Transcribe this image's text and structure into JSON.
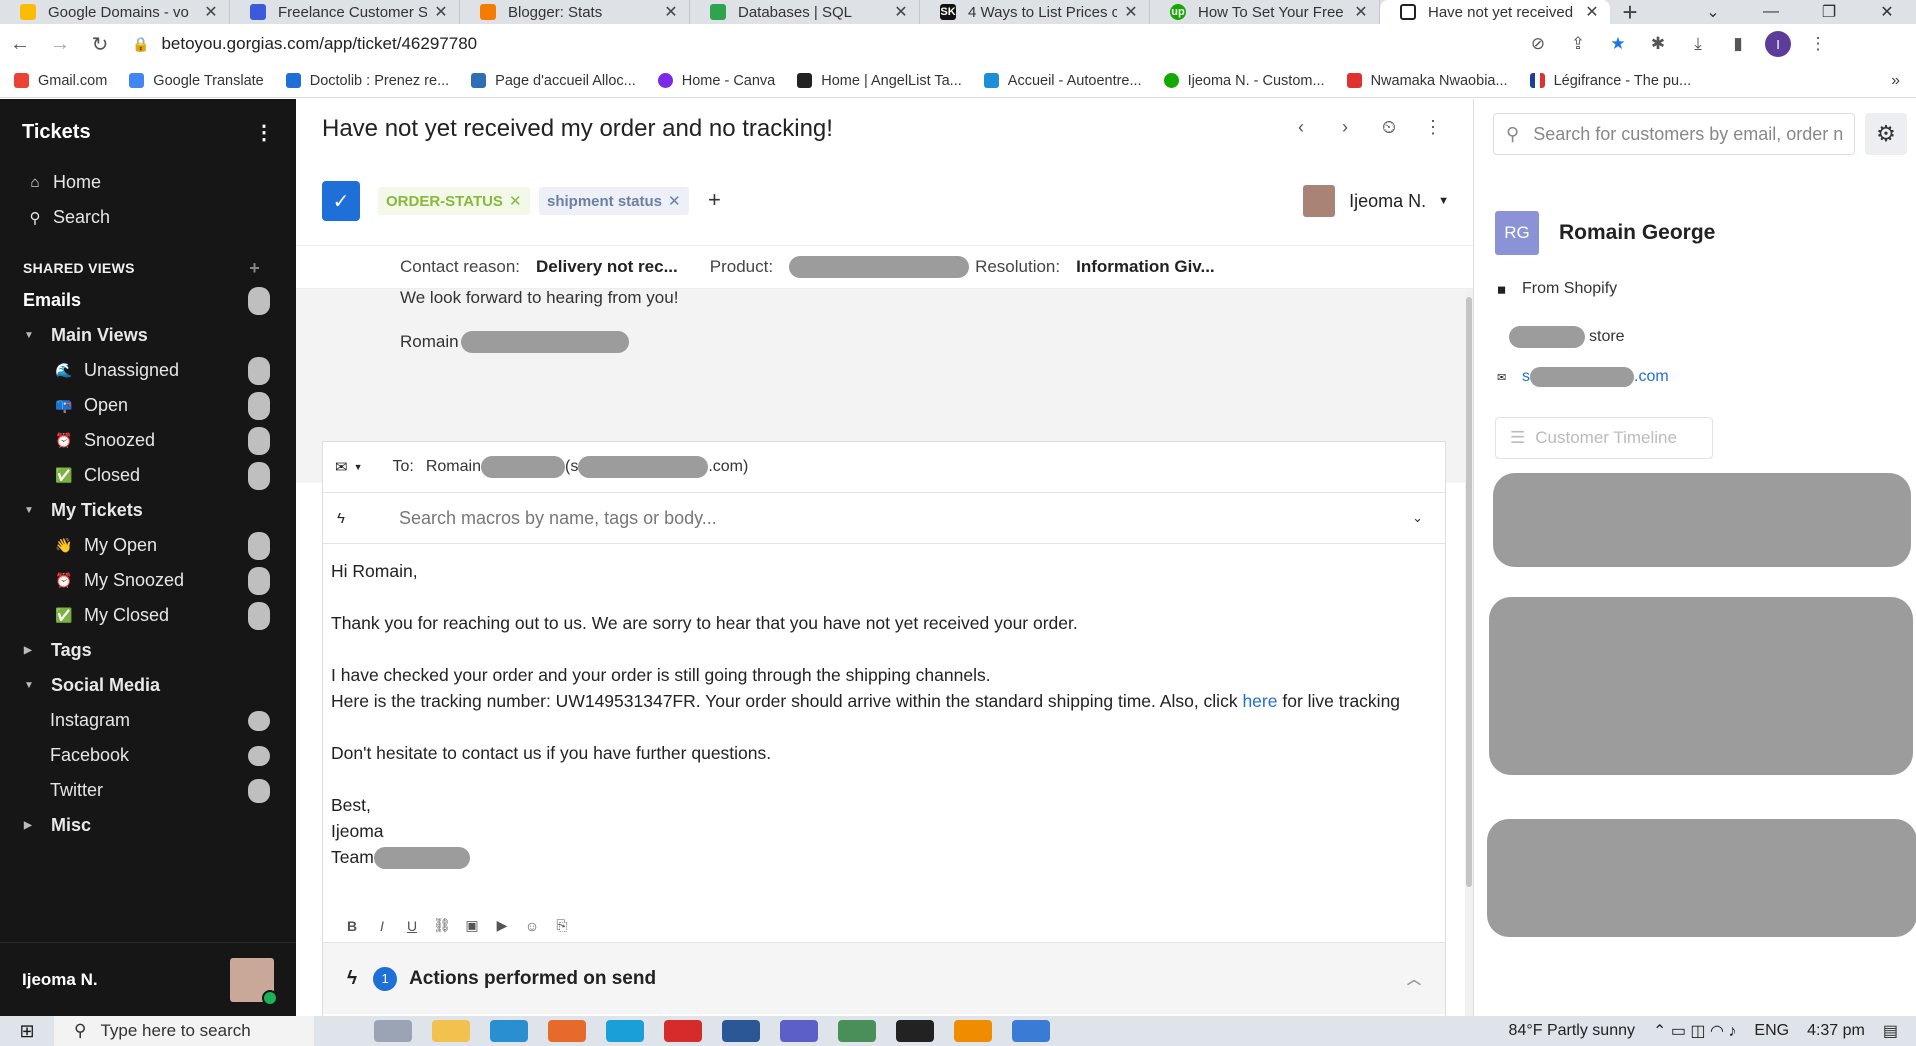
{
  "browser": {
    "tabs": [
      {
        "label": "Google Domains - vo",
        "color": "#fbbc04"
      },
      {
        "label": "Freelance Customer S",
        "color": "#3b5bdb"
      },
      {
        "label": "Blogger: Stats",
        "color": "#f57c00"
      },
      {
        "label": "Databases | SQL",
        "color": "#2ea44f"
      },
      {
        "label": "4 Ways to List Prices c",
        "color": "#111111"
      },
      {
        "label": "How To Set Your Free",
        "color": "#14a800"
      },
      {
        "label": "Have not yet received",
        "color": "#222222"
      }
    ],
    "tab_icons": [
      "",
      "",
      "",
      "",
      "SK",
      "up",
      ""
    ],
    "url": "betoyou.gorgias.com/app/ticket/46297780",
    "bookmarks": [
      {
        "label": "Gmail.com",
        "color": "#ea4335"
      },
      {
        "label": "Google Translate",
        "color": "#4285f4"
      },
      {
        "label": "Doctolib : Prenez re...",
        "color": "#1f6fd8"
      },
      {
        "label": "Page d'accueil Alloc...",
        "color": "#2d6fb5"
      },
      {
        "label": "Home - Canva",
        "color": "#7d2ae8"
      },
      {
        "label": "Home | AngelList Ta...",
        "color": "#222222"
      },
      {
        "label": "Accueil - Autoentre...",
        "color": "#1c8fd8"
      },
      {
        "label": "Ijeoma N. - Custom...",
        "color": "#14a800"
      },
      {
        "label": "Nwamaka Nwaobia...",
        "color": "#e03131"
      },
      {
        "label": "Légifrance - The pu...",
        "color": "#1f3d99"
      }
    ],
    "profile_initial": "I"
  },
  "sidebar": {
    "title": "Tickets",
    "home": "Home",
    "search": "Search",
    "shared_views": "SHARED VIEWS",
    "emails": "Emails",
    "main_views": "Main Views",
    "main_items": [
      "Unassigned",
      "Open",
      "Snoozed",
      "Closed"
    ],
    "my_tickets": "My Tickets",
    "my_items": [
      "My Open",
      "My Snoozed",
      "My Closed"
    ],
    "tags": "Tags",
    "social_media": "Social Media",
    "social_items": [
      "Instagram",
      "Facebook",
      "Twitter"
    ],
    "misc": "Misc",
    "user": "Ijeoma N."
  },
  "ticket": {
    "title": "Have not yet received my order and no tracking!",
    "tags": [
      "ORDER-STATUS",
      "shipment status"
    ],
    "assignee": "Ijeoma N.",
    "snooze_badge": "Z",
    "fields": {
      "contact_reason_label": "Contact reason:",
      "contact_reason_value": "Delivery not rec...",
      "product_label": "Product:",
      "resolution_label": "Resolution:",
      "resolution_value": "Information Giv..."
    },
    "prev_message": {
      "line1": "We look forward to hearing from you!",
      "signature": "Romain"
    }
  },
  "composer": {
    "to_label": "To:",
    "to_name": "Romain",
    "to_email_open": "(s",
    "to_email_end": ".com)",
    "macro_placeholder": "Search macros by name, tags or body...",
    "greeting": "Hi Romain,",
    "p1": "Thank you for reaching out to us. We are sorry to hear that you have not yet received your order.",
    "p2a": "I have checked your order and your order is still going through the shipping channels.",
    "p2b": "Here is the tracking number: UW149531347FR. Your order should arrive within the standard shipping time. Also, click",
    "p2_link": "here",
    "p2c": "for live tracking",
    "p3": "Don't hesitate to contact us if you have further questions.",
    "closing": "Best,",
    "name": "Ijeoma",
    "team": "Team",
    "actions_count": "1",
    "actions_label": "Actions performed on send"
  },
  "customer": {
    "search_placeholder": "Search for customers by email, order n",
    "initials": "RG",
    "name": "Romain George",
    "source": "From Shopify",
    "store_suffix": "store",
    "email_start": "s",
    "email_end": ".com",
    "timeline_label": "Customer Timeline"
  },
  "taskbar": {
    "search_placeholder": "Type here to search",
    "weather": "84°F  Partly sunny",
    "lang": "ENG",
    "time": "4:37 pm"
  }
}
